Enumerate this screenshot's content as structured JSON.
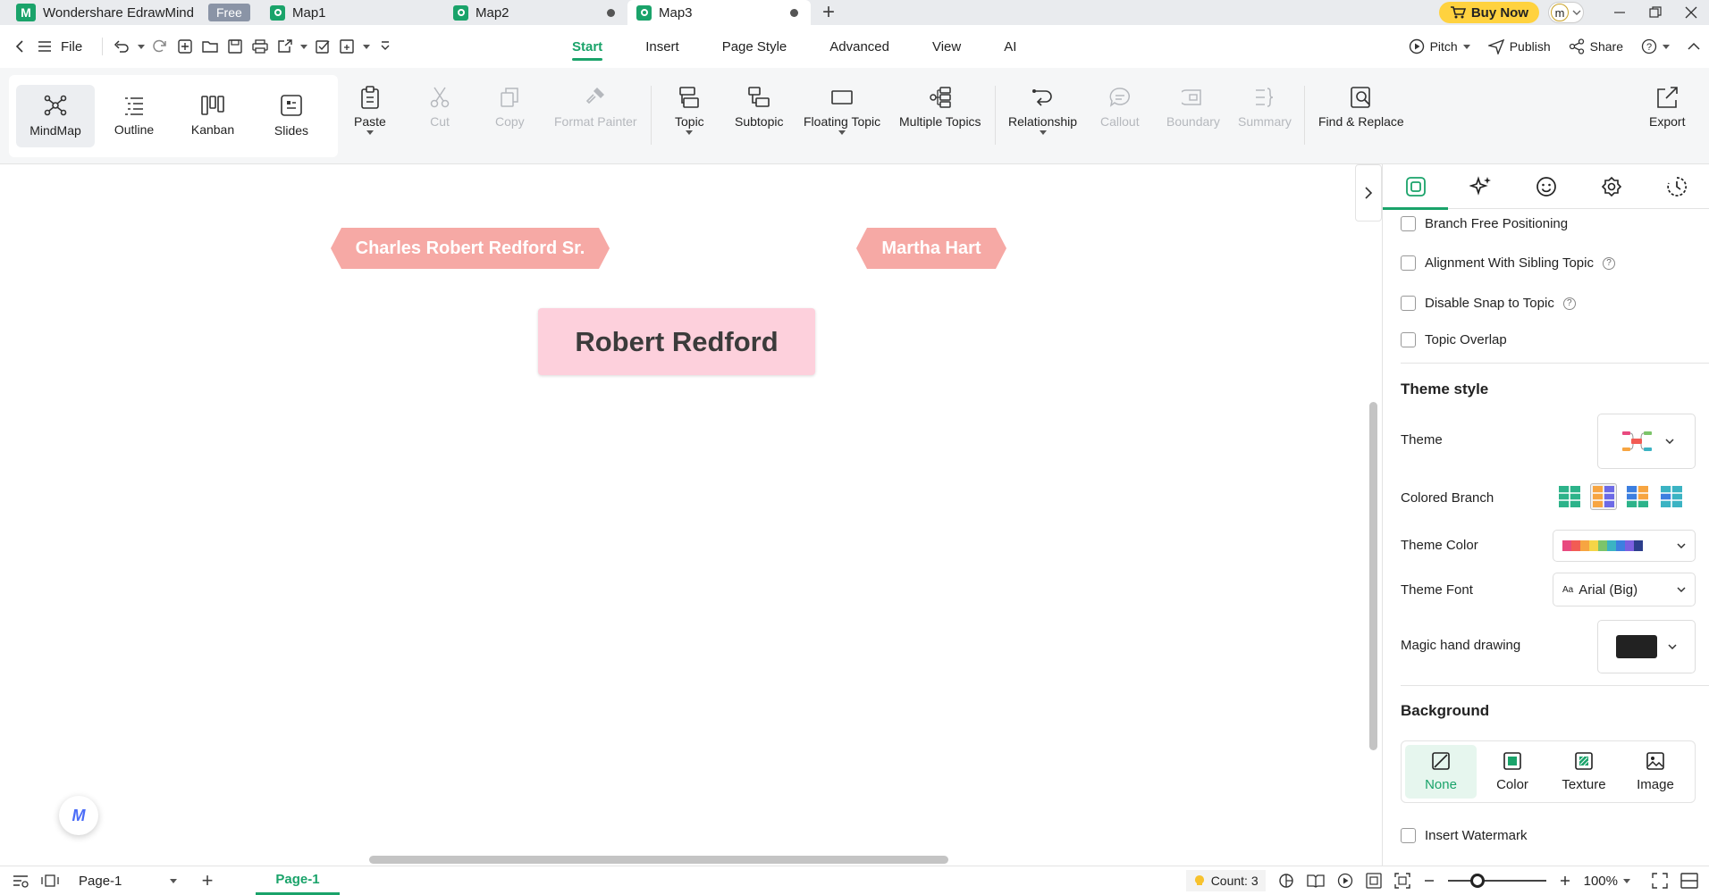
{
  "titlebar": {
    "app_name": "Wondershare EdrawMind",
    "badge": "Free",
    "tabs": [
      {
        "label": "Map1",
        "unsaved": false
      },
      {
        "label": "Map2",
        "unsaved": true
      },
      {
        "label": "Map3",
        "unsaved": true,
        "active": true
      }
    ],
    "buy_label": "Buy Now",
    "avatar_initial": "m"
  },
  "menubar": {
    "file_label": "File",
    "tabs": [
      "Start",
      "Insert",
      "Page Style",
      "Advanced",
      "View",
      "AI"
    ],
    "active_tab": "Start",
    "pitch_label": "Pitch",
    "publish_label": "Publish",
    "share_label": "Share"
  },
  "ribbon": {
    "views": [
      "MindMap",
      "Outline",
      "Kanban",
      "Slides"
    ],
    "active_view": "MindMap",
    "paste": "Paste",
    "cut": "Cut",
    "copy": "Copy",
    "format_painter": "Format Painter",
    "topic": "Topic",
    "subtopic": "Subtopic",
    "floating_topic": "Floating Topic",
    "multiple_topics": "Multiple Topics",
    "relationship": "Relationship",
    "callout": "Callout",
    "boundary": "Boundary",
    "summary": "Summary",
    "find_replace": "Find & Replace",
    "export": "Export"
  },
  "canvas": {
    "main_topic": "Robert Redford",
    "floating_topics": [
      "Charles Robert Redford Sr.",
      "Martha Hart"
    ]
  },
  "panel": {
    "options": [
      {
        "label": "Branch Free Positioning",
        "checked": false,
        "help": false
      },
      {
        "label": "Alignment With Sibling Topic",
        "checked": false,
        "help": true
      },
      {
        "label": "Disable Snap to Topic",
        "checked": false,
        "help": true
      },
      {
        "label": "Topic Overlap",
        "checked": false,
        "help": false
      }
    ],
    "theme_style_title": "Theme style",
    "theme_label": "Theme",
    "colored_branch_label": "Colored Branch",
    "theme_color_label": "Theme Color",
    "theme_font_label": "Theme Font",
    "theme_font_value": "Arial (Big)",
    "theme_font_prefix": "Aa",
    "magic_hand_label": "Magic hand drawing",
    "background_title": "Background",
    "background_options": [
      "None",
      "Color",
      "Texture",
      "Image"
    ],
    "background_selected": "None",
    "insert_watermark": "Insert Watermark",
    "theme_colors": [
      "#e84a7f",
      "#f25c54",
      "#f7a541",
      "#f5d547",
      "#7cc46a",
      "#3bb3c3",
      "#3d7fe0",
      "#7b5fe0",
      "#2c3e8c"
    ]
  },
  "statusbar": {
    "page_select": "Page-1",
    "page_tab": "Page-1",
    "count_label": "Count: 3",
    "zoom_label": "100%",
    "zoom_level": 0.3
  },
  "colors": {
    "accent": "#1aa36a",
    "side_topic": "#f6a9a5",
    "main_topic": "#fdd0dc"
  }
}
